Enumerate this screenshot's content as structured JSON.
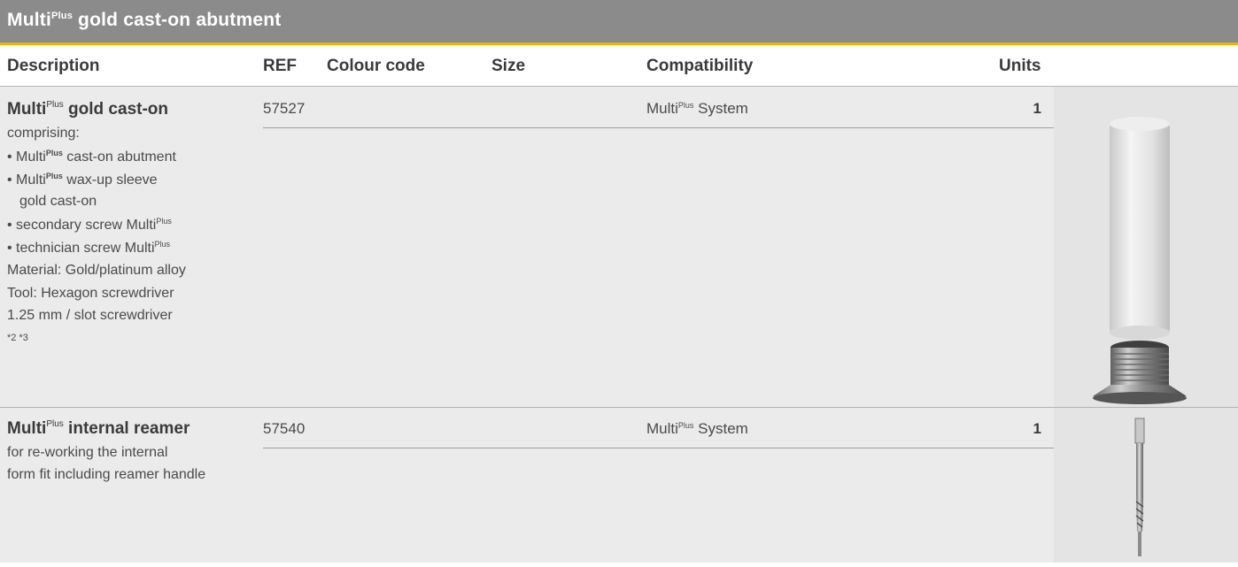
{
  "title": {
    "base": "Multi",
    "sup": "Plus",
    "rest": " gold cast-on abutment"
  },
  "headers": {
    "description": "Description",
    "ref": "REF",
    "colour_code": "Colour code",
    "size": "Size",
    "compatibility": "Compatibility",
    "units": "Units"
  },
  "products": [
    {
      "name_base": "Multi",
      "name_sup": "Plus",
      "name_rest": " gold cast-on",
      "description": {
        "intro": "comprising:",
        "items": [
          {
            "bullet": "• ",
            "base": "Multi",
            "sup": "Plus",
            "rest": " cast-on abutment"
          },
          {
            "bullet": "• ",
            "base": "Multi",
            "sup": "Plus",
            "rest": " wax-up sleeve"
          },
          {
            "bullet": "",
            "base": "",
            "sup": "",
            "rest": "gold cast-on"
          },
          {
            "bullet": "• ",
            "base": "secondary screw Multi",
            "sup": "Plus",
            "rest": ""
          },
          {
            "bullet": "• ",
            "base": "technician screw Multi",
            "sup": "Plus",
            "rest": ""
          }
        ],
        "material": "Material: Gold/platinum alloy",
        "tool_1": "Tool: Hexagon screwdriver",
        "tool_2": "1.25 mm / slot screwdriver",
        "footnote": "*2 *3"
      },
      "ref": "57527",
      "colour_code": "",
      "size": "",
      "compatibility_base": "Multi",
      "compatibility_sup": "Plus",
      "compatibility_rest": " System",
      "units": "1",
      "image_icon": "abutment-image"
    },
    {
      "name_base": "Multi",
      "name_sup": "Plus",
      "name_rest": " internal reamer",
      "description": {
        "line_1": "for re-working the internal",
        "line_2": "form fit including reamer handle"
      },
      "ref": "57540",
      "colour_code": "",
      "size": "",
      "compatibility_base": "Multi",
      "compatibility_sup": "Plus",
      "compatibility_rest": " System",
      "units": "1",
      "image_icon": "reamer-image"
    }
  ],
  "colors": {
    "title_bg": "#8b8b8b",
    "accent": "#f0b400",
    "row_bg": "#ebebeb"
  }
}
